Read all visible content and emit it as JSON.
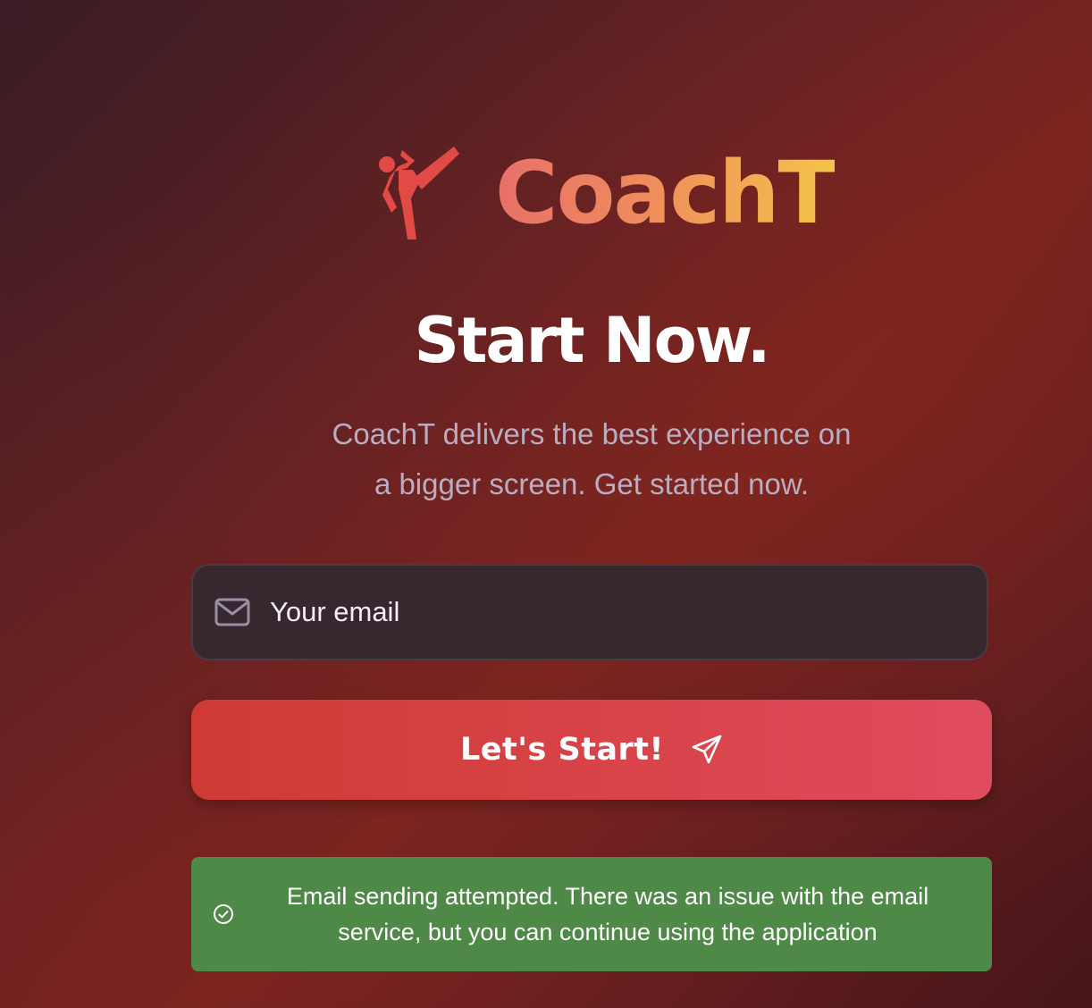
{
  "brand": {
    "name": "CoachT",
    "logo_icon": "martial-arts-kick-icon",
    "gradient_colors": [
      "#e8706a",
      "#ef8c5c",
      "#f4c44a"
    ],
    "icon_color": "#e24a45"
  },
  "hero": {
    "title": "Start Now.",
    "subtitle_line1": "CoachT delivers the best experience on",
    "subtitle_line2": "a bigger screen. Get started now."
  },
  "form": {
    "email_placeholder": "Your email",
    "email_value": "",
    "email_icon": "mail-icon",
    "submit_label": "Let's Start!",
    "submit_icon": "send-icon",
    "submit_color": "#d84449"
  },
  "toast": {
    "icon": "check-circle-icon",
    "line1": "Email sending attempted. There was an issue with the email",
    "line2": "service, but you can continue using the application",
    "color": "#4f8948"
  }
}
